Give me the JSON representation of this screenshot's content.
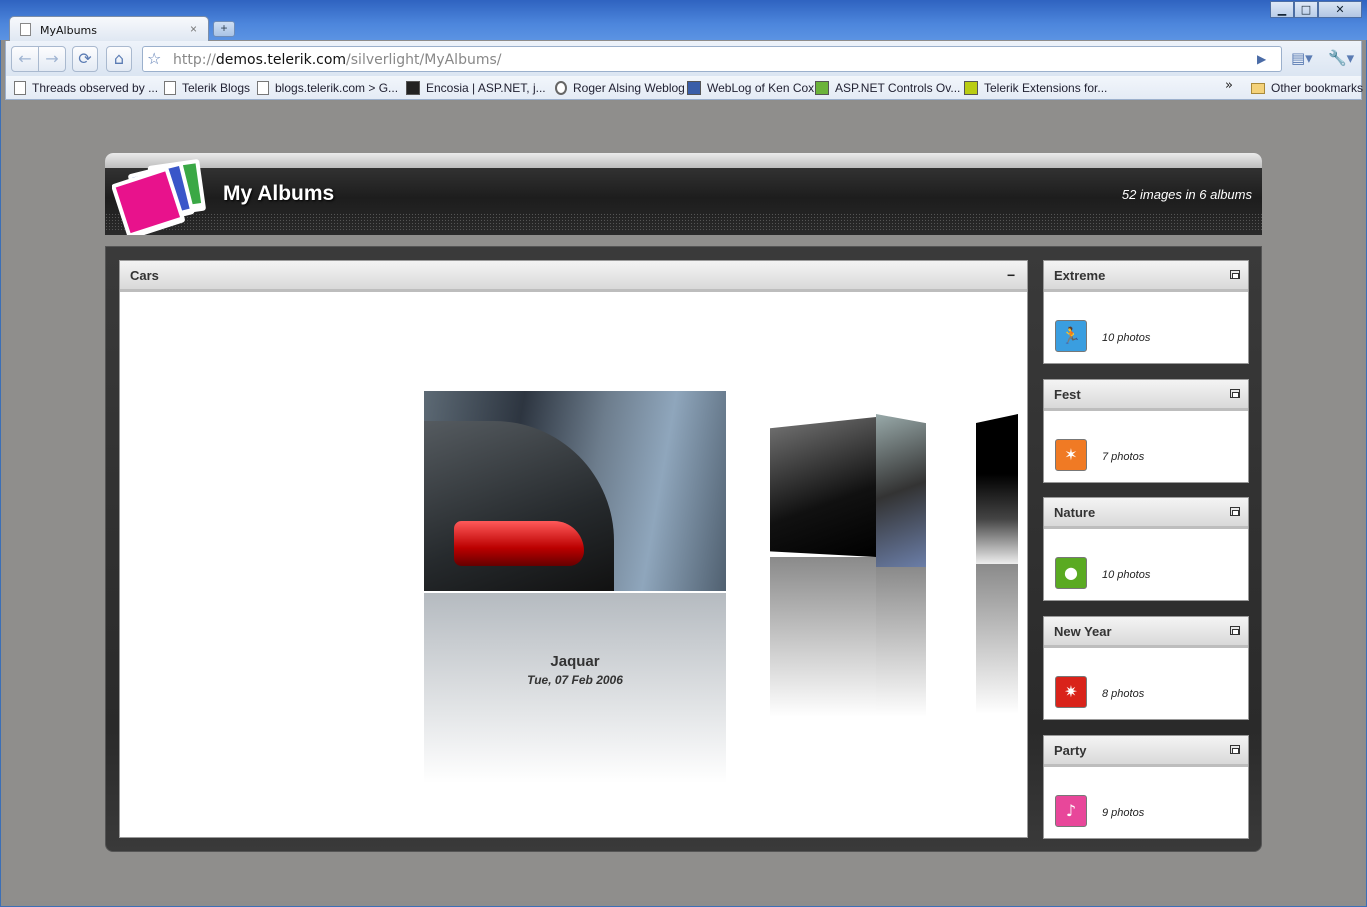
{
  "browser": {
    "tab_title": "MyAlbums",
    "tab_close": "×",
    "new_tab": "+",
    "window_buttons": {
      "minimize": "▁",
      "maximize": "□",
      "close": "✕"
    },
    "back": "←",
    "forward": "→",
    "reload": "⟳",
    "home": "⌂",
    "star": "☆",
    "url_prefix": "http://",
    "url_host": "demos.telerik.com",
    "url_path": "/silverlight/MyAlbums/",
    "go": "▶",
    "page_menu": "▤▾",
    "tools_menu": "🔧▾",
    "bookmarks": [
      {
        "label": "Threads observed by ...",
        "icon": "page-icon"
      },
      {
        "label": "Telerik Blogs",
        "icon": "page-icon"
      },
      {
        "label": "blogs.telerik.com > G...",
        "icon": "page-icon"
      },
      {
        "label": "Encosia | ASP.NET, j...",
        "icon": "encosia-icon"
      },
      {
        "label": "Roger Alsing Weblog",
        "icon": "wordpress-icon"
      },
      {
        "label": "WebLog of Ken Cox",
        "icon": "aspnet-icon"
      },
      {
        "label": "ASP.NET Controls Ov...",
        "icon": "telerik-green-icon"
      },
      {
        "label": "Telerik Extensions for...",
        "icon": "telerik-yellow-icon"
      }
    ],
    "bookmarks_overflow": "»",
    "other_bookmarks": "Other bookmarks"
  },
  "app": {
    "title": "My Albums",
    "summary": "52 images in 6 albums"
  },
  "main_album": {
    "title": "Cars",
    "minimize": "−",
    "current_photo": {
      "name": "Jaquar",
      "date": "Tue, 07 Feb 2006"
    }
  },
  "albums": [
    {
      "title": "Extreme",
      "count": "10 photos",
      "icon": "running-person-icon",
      "color": "#3a9ee0"
    },
    {
      "title": "Fest",
      "count": "7 photos",
      "icon": "dancing-person-icon",
      "color": "#f07a24"
    },
    {
      "title": "Nature",
      "count": "10 photos",
      "icon": "globe-leaf-icon",
      "color": "#5aaa22"
    },
    {
      "title": "New Year",
      "count": "8 photos",
      "icon": "fireworks-icon",
      "color": "#d9231a"
    },
    {
      "title": "Party",
      "count": "9 photos",
      "icon": "party-person-icon",
      "color": "#e8479a"
    }
  ],
  "colors": {
    "header_bg": "#1d1d1d",
    "page_bg": "#8f8e8c",
    "chrome_blue": "#4d86dc"
  }
}
